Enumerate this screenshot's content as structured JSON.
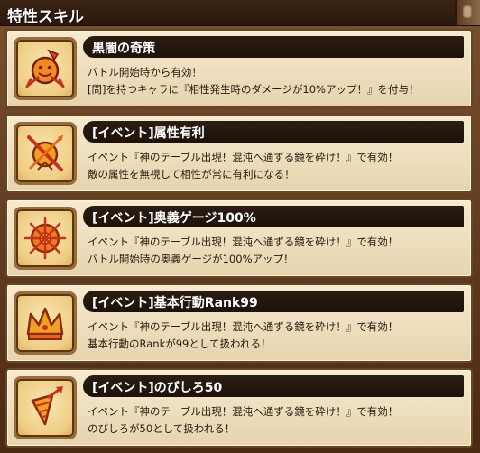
{
  "header": {
    "title": "特性スキル"
  },
  "skills": [
    {
      "icon": "smiling-bomb-icon",
      "title": "黒闇の奇策",
      "lines": [
        "バトル開始時から有効！",
        "[問]を持つキャラに『相性発生時のダメージが10%アップ！』を付与！"
      ]
    },
    {
      "icon": "crossed-sword-shield-icon",
      "title": "[イベント]属性有利",
      "lines": [
        "イベント『神のテーブル出現！混沌へ通ずる鏡を砕け！』で有効！",
        "敵の属性を無視して相性が常に有利になる！"
      ]
    },
    {
      "icon": "burst-emblem-icon",
      "title": "[イベント]奥義ゲージ100%",
      "lines": [
        "イベント『神のテーブル出現！混沌へ通ずる鏡を砕け！』で有効！",
        "バトル開始時の奥義ゲージが100%アップ！"
      ]
    },
    {
      "icon": "crown-icon",
      "title": "[イベント]基本行動Rank99",
      "lines": [
        "イベント『神のテーブル出現！混沌へ通ずる鏡を砕け！』で有効！",
        "基本行動のRankが99として扱われる！"
      ]
    },
    {
      "icon": "drill-arrow-icon",
      "title": "[イベント]のびしろ50",
      "lines": [
        "イベント『神のテーブル出現！混沌へ通ずる鏡を砕け！』で有効！",
        "のびしろが50として扱われる！"
      ]
    }
  ]
}
